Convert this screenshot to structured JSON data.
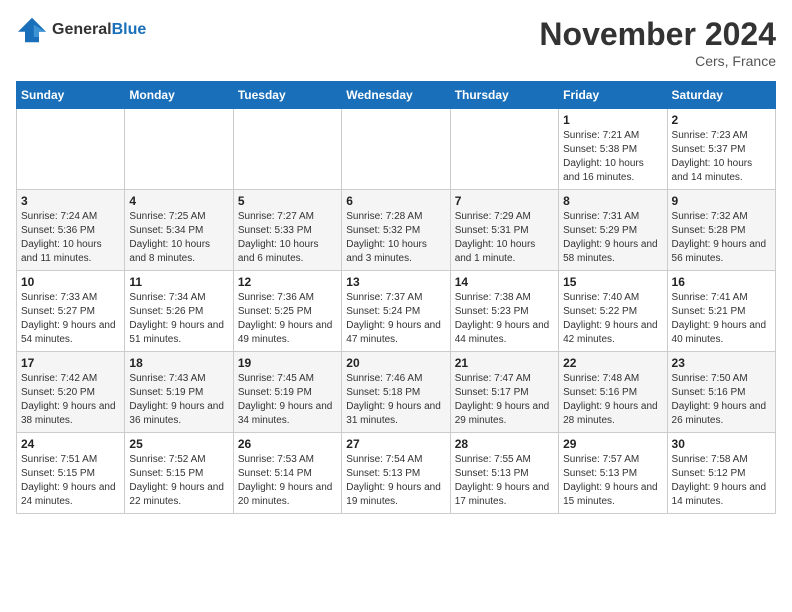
{
  "logo": {
    "line1": "General",
    "line2": "Blue"
  },
  "title": "November 2024",
  "location": "Cers, France",
  "weekdays": [
    "Sunday",
    "Monday",
    "Tuesday",
    "Wednesday",
    "Thursday",
    "Friday",
    "Saturday"
  ],
  "weeks": [
    [
      {
        "day": "",
        "info": ""
      },
      {
        "day": "",
        "info": ""
      },
      {
        "day": "",
        "info": ""
      },
      {
        "day": "",
        "info": ""
      },
      {
        "day": "",
        "info": ""
      },
      {
        "day": "1",
        "info": "Sunrise: 7:21 AM\nSunset: 5:38 PM\nDaylight: 10 hours and 16 minutes."
      },
      {
        "day": "2",
        "info": "Sunrise: 7:23 AM\nSunset: 5:37 PM\nDaylight: 10 hours and 14 minutes."
      }
    ],
    [
      {
        "day": "3",
        "info": "Sunrise: 7:24 AM\nSunset: 5:36 PM\nDaylight: 10 hours and 11 minutes."
      },
      {
        "day": "4",
        "info": "Sunrise: 7:25 AM\nSunset: 5:34 PM\nDaylight: 10 hours and 8 minutes."
      },
      {
        "day": "5",
        "info": "Sunrise: 7:27 AM\nSunset: 5:33 PM\nDaylight: 10 hours and 6 minutes."
      },
      {
        "day": "6",
        "info": "Sunrise: 7:28 AM\nSunset: 5:32 PM\nDaylight: 10 hours and 3 minutes."
      },
      {
        "day": "7",
        "info": "Sunrise: 7:29 AM\nSunset: 5:31 PM\nDaylight: 10 hours and 1 minute."
      },
      {
        "day": "8",
        "info": "Sunrise: 7:31 AM\nSunset: 5:29 PM\nDaylight: 9 hours and 58 minutes."
      },
      {
        "day": "9",
        "info": "Sunrise: 7:32 AM\nSunset: 5:28 PM\nDaylight: 9 hours and 56 minutes."
      }
    ],
    [
      {
        "day": "10",
        "info": "Sunrise: 7:33 AM\nSunset: 5:27 PM\nDaylight: 9 hours and 54 minutes."
      },
      {
        "day": "11",
        "info": "Sunrise: 7:34 AM\nSunset: 5:26 PM\nDaylight: 9 hours and 51 minutes."
      },
      {
        "day": "12",
        "info": "Sunrise: 7:36 AM\nSunset: 5:25 PM\nDaylight: 9 hours and 49 minutes."
      },
      {
        "day": "13",
        "info": "Sunrise: 7:37 AM\nSunset: 5:24 PM\nDaylight: 9 hours and 47 minutes."
      },
      {
        "day": "14",
        "info": "Sunrise: 7:38 AM\nSunset: 5:23 PM\nDaylight: 9 hours and 44 minutes."
      },
      {
        "day": "15",
        "info": "Sunrise: 7:40 AM\nSunset: 5:22 PM\nDaylight: 9 hours and 42 minutes."
      },
      {
        "day": "16",
        "info": "Sunrise: 7:41 AM\nSunset: 5:21 PM\nDaylight: 9 hours and 40 minutes."
      }
    ],
    [
      {
        "day": "17",
        "info": "Sunrise: 7:42 AM\nSunset: 5:20 PM\nDaylight: 9 hours and 38 minutes."
      },
      {
        "day": "18",
        "info": "Sunrise: 7:43 AM\nSunset: 5:19 PM\nDaylight: 9 hours and 36 minutes."
      },
      {
        "day": "19",
        "info": "Sunrise: 7:45 AM\nSunset: 5:19 PM\nDaylight: 9 hours and 34 minutes."
      },
      {
        "day": "20",
        "info": "Sunrise: 7:46 AM\nSunset: 5:18 PM\nDaylight: 9 hours and 31 minutes."
      },
      {
        "day": "21",
        "info": "Sunrise: 7:47 AM\nSunset: 5:17 PM\nDaylight: 9 hours and 29 minutes."
      },
      {
        "day": "22",
        "info": "Sunrise: 7:48 AM\nSunset: 5:16 PM\nDaylight: 9 hours and 28 minutes."
      },
      {
        "day": "23",
        "info": "Sunrise: 7:50 AM\nSunset: 5:16 PM\nDaylight: 9 hours and 26 minutes."
      }
    ],
    [
      {
        "day": "24",
        "info": "Sunrise: 7:51 AM\nSunset: 5:15 PM\nDaylight: 9 hours and 24 minutes."
      },
      {
        "day": "25",
        "info": "Sunrise: 7:52 AM\nSunset: 5:15 PM\nDaylight: 9 hours and 22 minutes."
      },
      {
        "day": "26",
        "info": "Sunrise: 7:53 AM\nSunset: 5:14 PM\nDaylight: 9 hours and 20 minutes."
      },
      {
        "day": "27",
        "info": "Sunrise: 7:54 AM\nSunset: 5:13 PM\nDaylight: 9 hours and 19 minutes."
      },
      {
        "day": "28",
        "info": "Sunrise: 7:55 AM\nSunset: 5:13 PM\nDaylight: 9 hours and 17 minutes."
      },
      {
        "day": "29",
        "info": "Sunrise: 7:57 AM\nSunset: 5:13 PM\nDaylight: 9 hours and 15 minutes."
      },
      {
        "day": "30",
        "info": "Sunrise: 7:58 AM\nSunset: 5:12 PM\nDaylight: 9 hours and 14 minutes."
      }
    ]
  ]
}
